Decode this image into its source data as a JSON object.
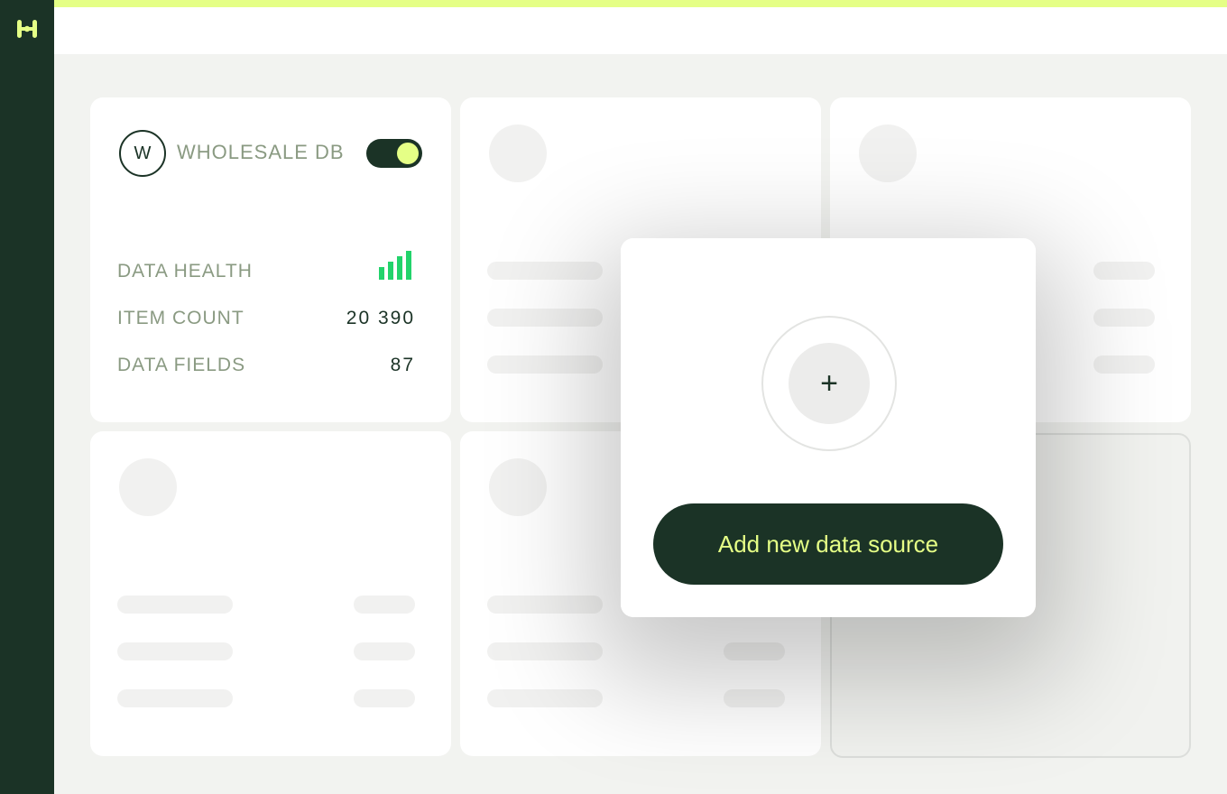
{
  "sidebar": {
    "logo_icon": "brand-logo-icon"
  },
  "colors": {
    "dark": "#1b3326",
    "accent": "#e5ff86",
    "muted": "#8a9a82",
    "signal": "#22d36b"
  },
  "source_card": {
    "avatar_letter": "W",
    "title": "WHOLESALE DB",
    "enabled": true,
    "stats": [
      {
        "label": "DATA HEALTH",
        "value": "",
        "icon": "signal-bars-icon",
        "level_bars": 4
      },
      {
        "label": "ITEM COUNT",
        "value": "20 390"
      },
      {
        "label": "DATA FIELDS",
        "value": "87"
      }
    ]
  },
  "modal": {
    "plus_icon": "+",
    "button_label": "Add new data source"
  }
}
